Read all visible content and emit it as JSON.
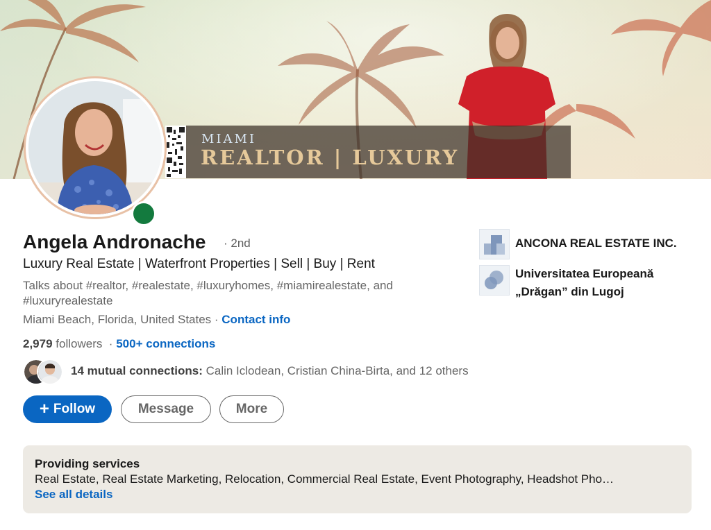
{
  "banner": {
    "small_text": "MIAMI",
    "big_text": "REALTOR | LUXURY"
  },
  "profile": {
    "name": "Angela Andronache",
    "degree": "· 2nd",
    "headline": "Luxury Real Estate | Waterfront Properties | Sell | Buy | Rent",
    "talks_about": "Talks about #realtor, #realestate, #luxuryhomes, #miamirealestate, and #luxuryrealestate",
    "location": "Miami Beach, Florida, United States",
    "location_sep": " · ",
    "contact_info": "Contact info",
    "followers_count": "2,979",
    "followers_label": " followers",
    "connections_sep": "  · ",
    "connections": "500+ connections",
    "mutual_bold": "14 mutual connections:",
    "mutual_rest": " Calin Iclodean, Cristian China-Birta, and 12 others"
  },
  "actions": {
    "follow_plus": "+",
    "follow": "Follow",
    "message": "Message",
    "more": "More"
  },
  "organizations": [
    {
      "name": "ANCONA REAL ESTATE INC."
    },
    {
      "name_line1": "Universitatea Europeană",
      "name_line2": "„Drăgan” din Lugoj"
    }
  ],
  "services": {
    "title": "Providing services",
    "list": "Real Estate, Real Estate Marketing, Relocation, Commercial Real Estate, Event Photography, Headshot Pho…",
    "link": "See all details"
  },
  "colors": {
    "link_blue": "#0a66c2",
    "presence_green": "#137a3e",
    "services_bg": "#edeae4"
  }
}
